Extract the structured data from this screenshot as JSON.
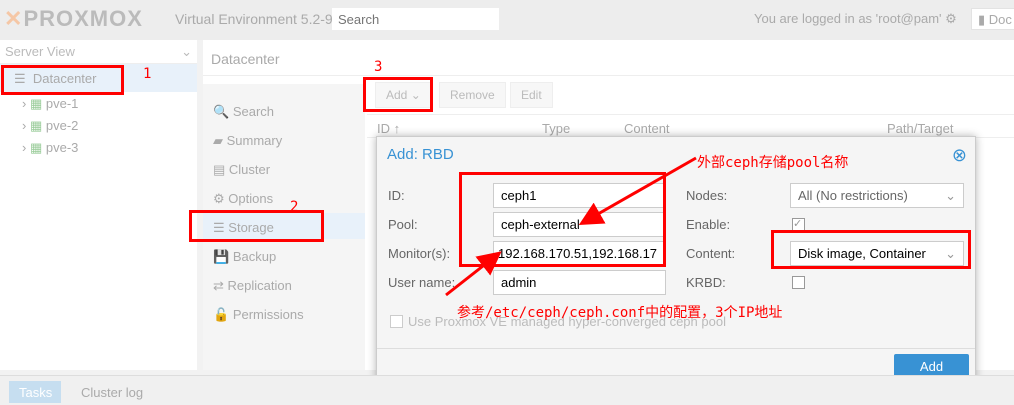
{
  "header": {
    "logo": "PROXMOX",
    "version": "Virtual Environment 5.2-9",
    "search_placeholder": "Search",
    "login": "You are logged in as 'root@pam'",
    "docs": "Doc"
  },
  "tree": {
    "view": "Server View",
    "root": "Datacenter",
    "nodes": [
      "pve-1",
      "pve-2",
      "pve-3"
    ]
  },
  "center": {
    "title": "Datacenter",
    "nav": [
      "Search",
      "Summary",
      "Cluster",
      "Options",
      "Storage",
      "Backup",
      "Replication",
      "Permissions"
    ],
    "toolbar": {
      "add": "Add",
      "remove": "Remove",
      "edit": "Edit"
    },
    "columns": [
      "ID ↑",
      "Type",
      "Content",
      "Path/Target"
    ]
  },
  "dialog": {
    "title": "Add: RBD",
    "fields": {
      "id_label": "ID:",
      "id": "ceph1",
      "pool_label": "Pool:",
      "pool": "ceph-external",
      "monitor_label": "Monitor(s):",
      "monitor": "192.168.170.51,192.168.17",
      "user_label": "User name:",
      "user": "admin",
      "nodes_label": "Nodes:",
      "nodes": "All (No restrictions)",
      "enable_label": "Enable:",
      "content_label": "Content:",
      "content": "Disk image, Container",
      "krbd_label": "KRBD:",
      "hyper": "Use Proxmox VE managed hyper-converged ceph pool"
    },
    "add": "Add"
  },
  "annotations": {
    "n1": "1",
    "n2": "2",
    "n3": "3",
    "pool_note": "外部ceph存储pool名称",
    "monitor_note": "参考/etc/ceph/ceph.conf中的配置，3个IP地址"
  },
  "bottom": {
    "tasks": "Tasks",
    "cluster_log": "Cluster log"
  }
}
